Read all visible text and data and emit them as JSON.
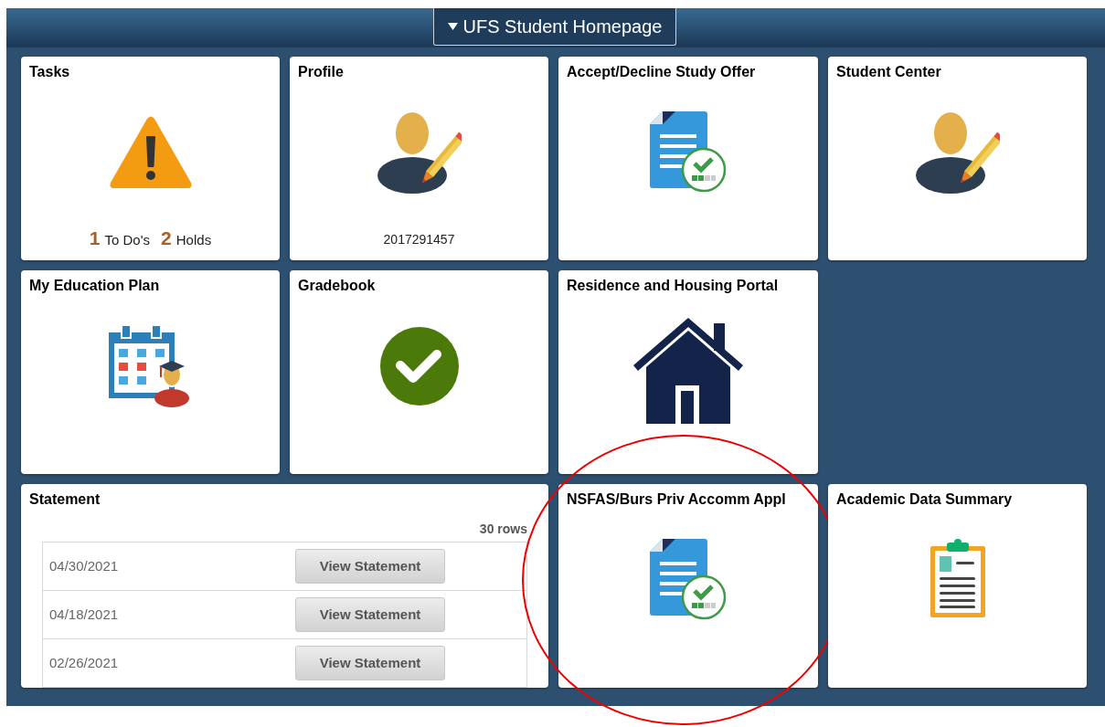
{
  "header": {
    "title": "UFS Student Homepage"
  },
  "tiles": [
    {
      "kind": "tasks",
      "title": "Tasks",
      "circled": false,
      "counts": [
        {
          "number": "1",
          "item": "To Do's"
        },
        {
          "number": "2",
          "item": "Holds"
        }
      ]
    },
    {
      "kind": "profile",
      "title": "Profile",
      "circled": false,
      "footer": "2017291457"
    },
    {
      "kind": "document",
      "title": "Accept/Decline Study Offer",
      "circled": false
    },
    {
      "kind": "person",
      "title": "Student Center",
      "circled": false
    },
    {
      "kind": "calendar",
      "title": "My Education Plan",
      "circled": false
    },
    {
      "kind": "check",
      "title": "Gradebook",
      "circled": false
    },
    {
      "kind": "house",
      "title": "Residence and Housing Portal",
      "circled": false
    },
    {
      "kind": "statement",
      "title": "Statement",
      "circled": false,
      "row_count": "30 rows",
      "rows": [
        {
          "date": "04/30/2021",
          "button": "View Statement"
        },
        {
          "date": "04/18/2021",
          "button": "View Statement"
        },
        {
          "date": "02/26/2021",
          "button": "View Statement"
        }
      ]
    },
    {
      "kind": "document",
      "title": "NSFAS/Burs Priv Accomm Appl",
      "circled": true
    },
    {
      "kind": "clipboard",
      "title": "Academic Data Summary",
      "circled": false
    }
  ]
}
